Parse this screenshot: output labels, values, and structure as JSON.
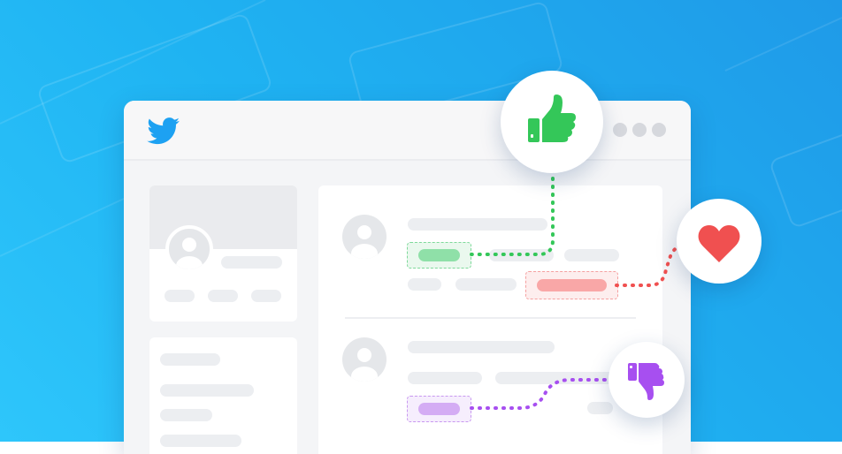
{
  "colors": {
    "background_start": "#2ec6fb",
    "background_end": "#1f9ae8",
    "brand_bird": "#1da1f2",
    "like_green": "#34c759",
    "heart_red": "#f05050",
    "dislike_purple": "#a74ff0",
    "skeleton_gray": "#eceef1"
  },
  "icons": {
    "logo": "bird-icon",
    "like": "thumbs-up-icon",
    "heart": "heart-icon",
    "dislike": "thumbs-down-icon",
    "avatar": "user-avatar-icon",
    "menu": "more-dots-icon"
  },
  "reactions": [
    {
      "name": "like",
      "color": "#34c759"
    },
    {
      "name": "heart",
      "color": "#f05050"
    },
    {
      "name": "dislike",
      "color": "#a74ff0"
    }
  ]
}
